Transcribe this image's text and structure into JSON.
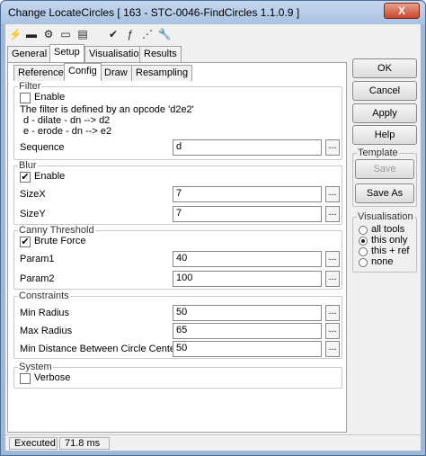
{
  "window": {
    "title": "Change LocateCircles [ 163 - STC-0046-FindCircles 1.1.0.9 ]",
    "close_label": "X"
  },
  "toolbar": {
    "icons": [
      "lightning-icon",
      "link-icon",
      "gear-icon",
      "folder-icon",
      "notes-icon",
      "check-icon",
      "function-icon",
      "grid-icon",
      "wrench-icon"
    ],
    "glyphs": [
      "⚡",
      "▬",
      "⚙",
      "▭",
      "▤",
      "✔",
      "ƒ",
      "⋰",
      "🔧"
    ]
  },
  "main_tabs": [
    "General",
    "Setup",
    "Visualisation",
    "Results"
  ],
  "sub_tabs": [
    "Reference",
    "Config",
    "Draw",
    "Resampling"
  ],
  "filter": {
    "legend": "Filter",
    "enable_label": "Enable",
    "enabled": false,
    "desc1": "The filter is defined by an opcode 'd2e2'",
    "desc2": "d - dilate - dn --> d2",
    "desc3": "e - erode - dn --> e2",
    "sequence_label": "Sequence",
    "sequence_value": "d"
  },
  "blur": {
    "legend": "Blur",
    "enable_label": "Enable",
    "enabled": true,
    "sizex_label": "SizeX",
    "sizex_value": "7",
    "sizey_label": "SizeY",
    "sizey_value": "7"
  },
  "canny": {
    "legend": "Canny Threshold",
    "brute_label": "Brute Force",
    "brute": true,
    "param1_label": "Param1",
    "param1_value": "40",
    "param2_label": "Param2",
    "param2_value": "100"
  },
  "constraints": {
    "legend": "Constraints",
    "minr_label": "Min Radius",
    "minr_value": "50",
    "maxr_label": "Max Radius",
    "maxr_value": "65",
    "mind_label": "Min Distance Between Circle Centers",
    "mind_value": "50"
  },
  "system": {
    "legend": "System",
    "verbose_label": "Verbose",
    "verbose": false
  },
  "ellipsis": "...",
  "buttons": {
    "ok": "OK",
    "cancel": "Cancel",
    "apply": "Apply",
    "help": "Help",
    "save": "Save",
    "save_as": "Save As"
  },
  "template": {
    "legend": "Template"
  },
  "visualisation": {
    "legend": "Visualisation",
    "options": [
      "all tools",
      "this only",
      "this + ref",
      "none"
    ],
    "selected": "this only"
  },
  "status": {
    "state": "Executed",
    "time": "71.8 ms"
  },
  "check_mark": "✔"
}
